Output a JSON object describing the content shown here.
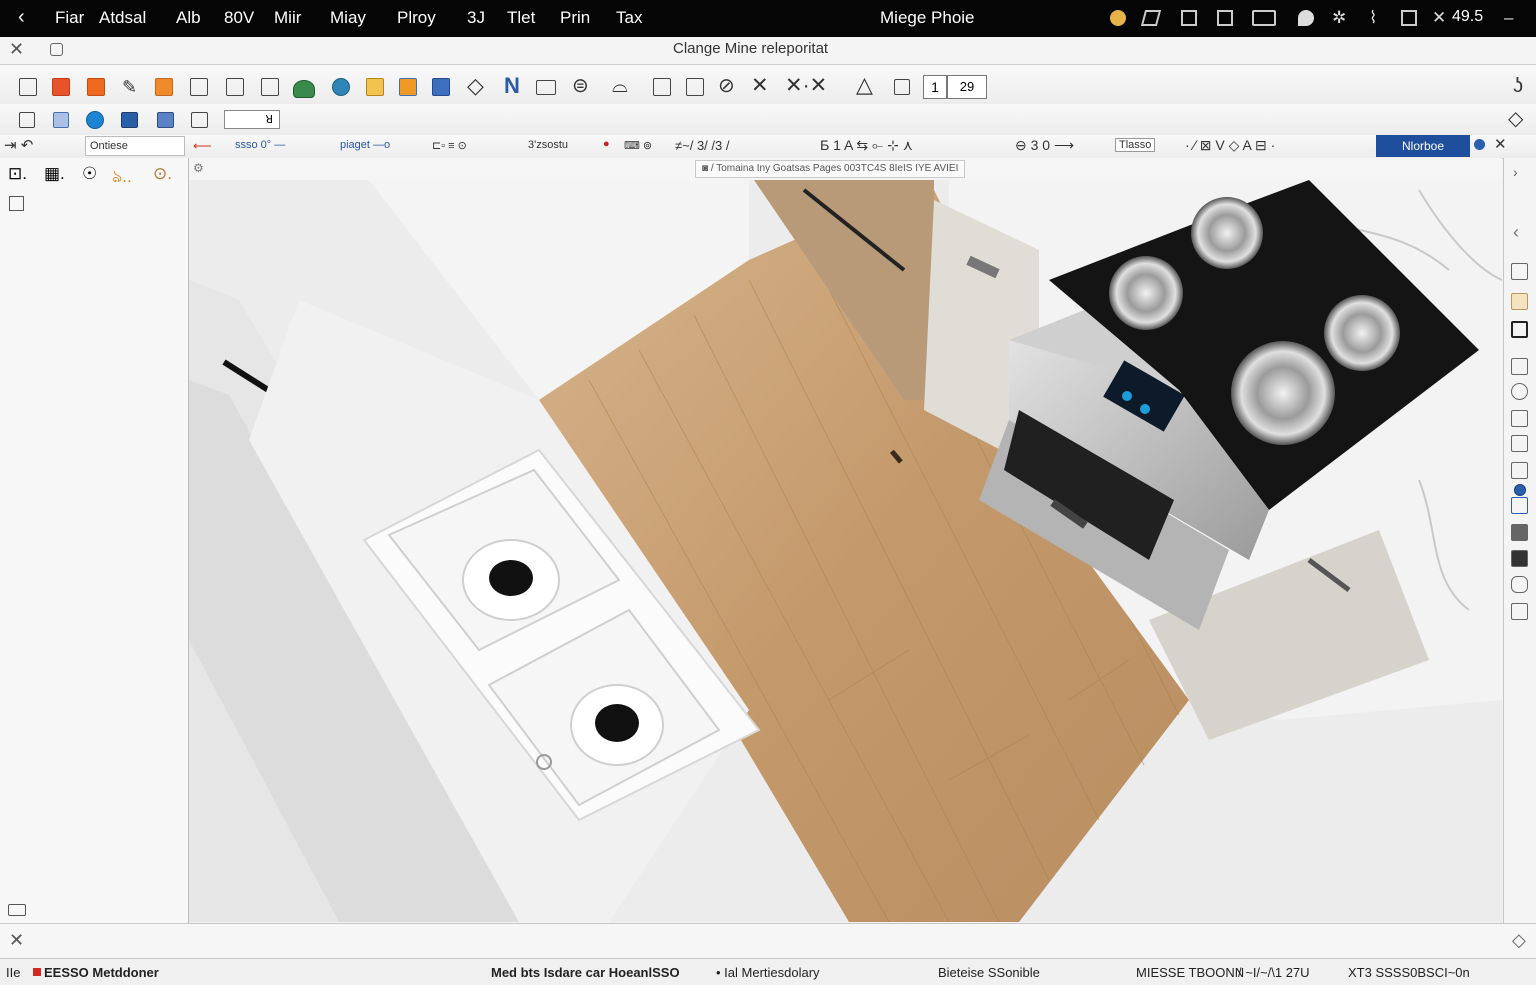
{
  "menubar": {
    "items": [
      "Fiar",
      "Atdsal",
      "Alb",
      "80V",
      "Miir",
      "Miay",
      "Plroy",
      "3J",
      "Tlet",
      "Prin",
      "Tax"
    ],
    "right_title": "Miege Phoie",
    "clock": "49.5"
  },
  "titlebar": {
    "title": "Clange Mine releporitat"
  },
  "toolbar1": {
    "field_a": "1",
    "field_b": "29"
  },
  "toolbar2": {
    "field": "ꓤ"
  },
  "toolbar3": {
    "left_label": "Ontiese",
    "seg1": "ssso 0° —",
    "seg2": "piaget —o",
    "seg3": "3'zsostu",
    "seg4": "≠~/ 3/ /3 /",
    "seg5": "Tlasso",
    "active_button": "Nlorboe"
  },
  "doc_tab": {
    "label": "/ Tomaina Iny Goatsas Pages 003TC4S 8IeIS IYE AVIEI"
  },
  "statusbar": {
    "left": "IIe",
    "left_tag": "EESSO Metddoner",
    "center": "Med bts Isdare car HoeanlSSO",
    "center2": "• Ial Mertiesdolary",
    "right1": "Bieteise SSonible",
    "right2": "MIESSE TBOONN",
    "right3": "/ ~I/~/\\1 27U",
    "right4": "XT3 SSSS0BSCI~0n"
  },
  "colors": {
    "accent": "#1f4f9c",
    "menubar_bg": "#050505",
    "wood": "#c8a27a"
  }
}
